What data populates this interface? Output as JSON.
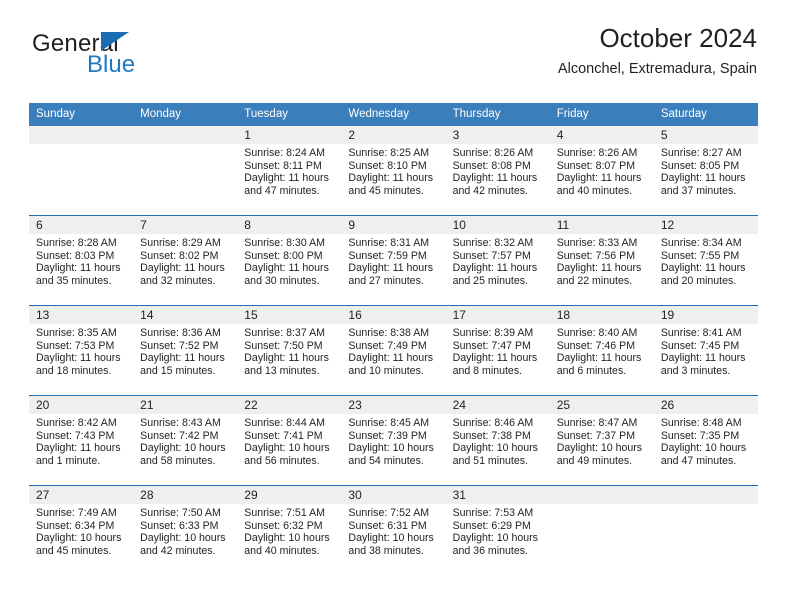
{
  "brand": {
    "name_top": "General",
    "name_bottom": "Blue",
    "triangle_icon": "triangle-icon",
    "color_primary": "#1b6cb3",
    "color_text": "#231f20"
  },
  "header": {
    "title": "October 2024",
    "subtitle": "Alconchel, Extremadura, Spain"
  },
  "theme": {
    "header_blue": "#3b7ebc",
    "rule_blue": "#1f6cb0",
    "band_gray": "#efefef"
  },
  "weekday_headers": [
    "Sunday",
    "Monday",
    "Tuesday",
    "Wednesday",
    "Thursday",
    "Friday",
    "Saturday"
  ],
  "weeks": [
    [
      {
        "day": "",
        "sunrise": "",
        "sunset": "",
        "daylight_1": "",
        "daylight_2": "",
        "empty": true
      },
      {
        "day": "",
        "sunrise": "",
        "sunset": "",
        "daylight_1": "",
        "daylight_2": "",
        "empty": true
      },
      {
        "day": "1",
        "sunrise": "Sunrise: 8:24 AM",
        "sunset": "Sunset: 8:11 PM",
        "daylight_1": "Daylight: 11 hours",
        "daylight_2": "and 47 minutes."
      },
      {
        "day": "2",
        "sunrise": "Sunrise: 8:25 AM",
        "sunset": "Sunset: 8:10 PM",
        "daylight_1": "Daylight: 11 hours",
        "daylight_2": "and 45 minutes."
      },
      {
        "day": "3",
        "sunrise": "Sunrise: 8:26 AM",
        "sunset": "Sunset: 8:08 PM",
        "daylight_1": "Daylight: 11 hours",
        "daylight_2": "and 42 minutes."
      },
      {
        "day": "4",
        "sunrise": "Sunrise: 8:26 AM",
        "sunset": "Sunset: 8:07 PM",
        "daylight_1": "Daylight: 11 hours",
        "daylight_2": "and 40 minutes."
      },
      {
        "day": "5",
        "sunrise": "Sunrise: 8:27 AM",
        "sunset": "Sunset: 8:05 PM",
        "daylight_1": "Daylight: 11 hours",
        "daylight_2": "and 37 minutes."
      }
    ],
    [
      {
        "day": "6",
        "sunrise": "Sunrise: 8:28 AM",
        "sunset": "Sunset: 8:03 PM",
        "daylight_1": "Daylight: 11 hours",
        "daylight_2": "and 35 minutes."
      },
      {
        "day": "7",
        "sunrise": "Sunrise: 8:29 AM",
        "sunset": "Sunset: 8:02 PM",
        "daylight_1": "Daylight: 11 hours",
        "daylight_2": "and 32 minutes."
      },
      {
        "day": "8",
        "sunrise": "Sunrise: 8:30 AM",
        "sunset": "Sunset: 8:00 PM",
        "daylight_1": "Daylight: 11 hours",
        "daylight_2": "and 30 minutes."
      },
      {
        "day": "9",
        "sunrise": "Sunrise: 8:31 AM",
        "sunset": "Sunset: 7:59 PM",
        "daylight_1": "Daylight: 11 hours",
        "daylight_2": "and 27 minutes."
      },
      {
        "day": "10",
        "sunrise": "Sunrise: 8:32 AM",
        "sunset": "Sunset: 7:57 PM",
        "daylight_1": "Daylight: 11 hours",
        "daylight_2": "and 25 minutes."
      },
      {
        "day": "11",
        "sunrise": "Sunrise: 8:33 AM",
        "sunset": "Sunset: 7:56 PM",
        "daylight_1": "Daylight: 11 hours",
        "daylight_2": "and 22 minutes."
      },
      {
        "day": "12",
        "sunrise": "Sunrise: 8:34 AM",
        "sunset": "Sunset: 7:55 PM",
        "daylight_1": "Daylight: 11 hours",
        "daylight_2": "and 20 minutes."
      }
    ],
    [
      {
        "day": "13",
        "sunrise": "Sunrise: 8:35 AM",
        "sunset": "Sunset: 7:53 PM",
        "daylight_1": "Daylight: 11 hours",
        "daylight_2": "and 18 minutes."
      },
      {
        "day": "14",
        "sunrise": "Sunrise: 8:36 AM",
        "sunset": "Sunset: 7:52 PM",
        "daylight_1": "Daylight: 11 hours",
        "daylight_2": "and 15 minutes."
      },
      {
        "day": "15",
        "sunrise": "Sunrise: 8:37 AM",
        "sunset": "Sunset: 7:50 PM",
        "daylight_1": "Daylight: 11 hours",
        "daylight_2": "and 13 minutes."
      },
      {
        "day": "16",
        "sunrise": "Sunrise: 8:38 AM",
        "sunset": "Sunset: 7:49 PM",
        "daylight_1": "Daylight: 11 hours",
        "daylight_2": "and 10 minutes."
      },
      {
        "day": "17",
        "sunrise": "Sunrise: 8:39 AM",
        "sunset": "Sunset: 7:47 PM",
        "daylight_1": "Daylight: 11 hours",
        "daylight_2": "and 8 minutes."
      },
      {
        "day": "18",
        "sunrise": "Sunrise: 8:40 AM",
        "sunset": "Sunset: 7:46 PM",
        "daylight_1": "Daylight: 11 hours",
        "daylight_2": "and 6 minutes."
      },
      {
        "day": "19",
        "sunrise": "Sunrise: 8:41 AM",
        "sunset": "Sunset: 7:45 PM",
        "daylight_1": "Daylight: 11 hours",
        "daylight_2": "and 3 minutes."
      }
    ],
    [
      {
        "day": "20",
        "sunrise": "Sunrise: 8:42 AM",
        "sunset": "Sunset: 7:43 PM",
        "daylight_1": "Daylight: 11 hours",
        "daylight_2": "and 1 minute."
      },
      {
        "day": "21",
        "sunrise": "Sunrise: 8:43 AM",
        "sunset": "Sunset: 7:42 PM",
        "daylight_1": "Daylight: 10 hours",
        "daylight_2": "and 58 minutes."
      },
      {
        "day": "22",
        "sunrise": "Sunrise: 8:44 AM",
        "sunset": "Sunset: 7:41 PM",
        "daylight_1": "Daylight: 10 hours",
        "daylight_2": "and 56 minutes."
      },
      {
        "day": "23",
        "sunrise": "Sunrise: 8:45 AM",
        "sunset": "Sunset: 7:39 PM",
        "daylight_1": "Daylight: 10 hours",
        "daylight_2": "and 54 minutes."
      },
      {
        "day": "24",
        "sunrise": "Sunrise: 8:46 AM",
        "sunset": "Sunset: 7:38 PM",
        "daylight_1": "Daylight: 10 hours",
        "daylight_2": "and 51 minutes."
      },
      {
        "day": "25",
        "sunrise": "Sunrise: 8:47 AM",
        "sunset": "Sunset: 7:37 PM",
        "daylight_1": "Daylight: 10 hours",
        "daylight_2": "and 49 minutes."
      },
      {
        "day": "26",
        "sunrise": "Sunrise: 8:48 AM",
        "sunset": "Sunset: 7:35 PM",
        "daylight_1": "Daylight: 10 hours",
        "daylight_2": "and 47 minutes."
      }
    ],
    [
      {
        "day": "27",
        "sunrise": "Sunrise: 7:49 AM",
        "sunset": "Sunset: 6:34 PM",
        "daylight_1": "Daylight: 10 hours",
        "daylight_2": "and 45 minutes."
      },
      {
        "day": "28",
        "sunrise": "Sunrise: 7:50 AM",
        "sunset": "Sunset: 6:33 PM",
        "daylight_1": "Daylight: 10 hours",
        "daylight_2": "and 42 minutes."
      },
      {
        "day": "29",
        "sunrise": "Sunrise: 7:51 AM",
        "sunset": "Sunset: 6:32 PM",
        "daylight_1": "Daylight: 10 hours",
        "daylight_2": "and 40 minutes."
      },
      {
        "day": "30",
        "sunrise": "Sunrise: 7:52 AM",
        "sunset": "Sunset: 6:31 PM",
        "daylight_1": "Daylight: 10 hours",
        "daylight_2": "and 38 minutes."
      },
      {
        "day": "31",
        "sunrise": "Sunrise: 7:53 AM",
        "sunset": "Sunset: 6:29 PM",
        "daylight_1": "Daylight: 10 hours",
        "daylight_2": "and 36 minutes."
      },
      {
        "day": "",
        "sunrise": "",
        "sunset": "",
        "daylight_1": "",
        "daylight_2": "",
        "empty": true
      },
      {
        "day": "",
        "sunrise": "",
        "sunset": "",
        "daylight_1": "",
        "daylight_2": "",
        "empty": true
      }
    ]
  ]
}
